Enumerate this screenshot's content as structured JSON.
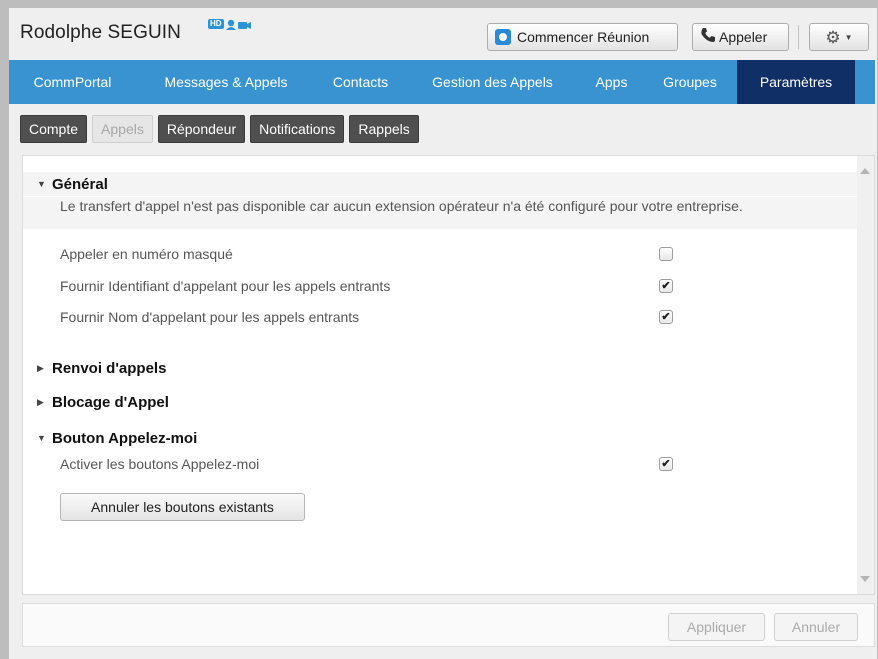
{
  "header": {
    "user_name": "Rodolphe SEGUIN",
    "hd_badge": "HD",
    "meeting_button": "Commencer Réunion",
    "call_button": "Appeler",
    "settings_icon": "gear-icon",
    "accent_color": "#2a8ad6"
  },
  "nav": {
    "items": [
      {
        "label": "CommPortal",
        "active": false
      },
      {
        "label": "Messages & Appels",
        "active": false
      },
      {
        "label": "Contacts",
        "active": false
      },
      {
        "label": "Gestion des Appels",
        "active": false
      },
      {
        "label": "Apps",
        "active": false
      },
      {
        "label": "Groupes",
        "active": false
      },
      {
        "label": "Paramètres",
        "active": true
      }
    ],
    "color": "#3993d1",
    "active_color": "#0f2f66"
  },
  "subtabs": [
    {
      "label": "Compte",
      "active": false
    },
    {
      "label": "Appels",
      "active": true
    },
    {
      "label": "Répondeur",
      "active": false
    },
    {
      "label": "Notifications",
      "active": false
    },
    {
      "label": "Rappels",
      "active": false
    }
  ],
  "sections": {
    "general": {
      "title": "Général",
      "expanded": true,
      "notice": "Le transfert d'appel n'est pas disponible car aucun extension opérateur n'a été configuré pour votre entreprise.",
      "rows": [
        {
          "label": "Appeler en numéro masqué",
          "checked": false
        },
        {
          "label": "Fournir Identifiant d'appelant pour les appels entrants",
          "checked": true
        },
        {
          "label": "Fournir Nom d'appelant pour les appels entrants",
          "checked": true
        }
      ]
    },
    "forwarding": {
      "title": "Renvoi d'appels",
      "expanded": false
    },
    "blocking": {
      "title": "Blocage d'Appel",
      "expanded": false
    },
    "callme": {
      "title": "Bouton Appelez-moi",
      "expanded": true,
      "row": {
        "label": "Activer les boutons Appelez-moi",
        "checked": true
      },
      "button": "Annuler les boutons existants"
    }
  },
  "footer": {
    "apply": "Appliquer",
    "cancel": "Annuler"
  }
}
